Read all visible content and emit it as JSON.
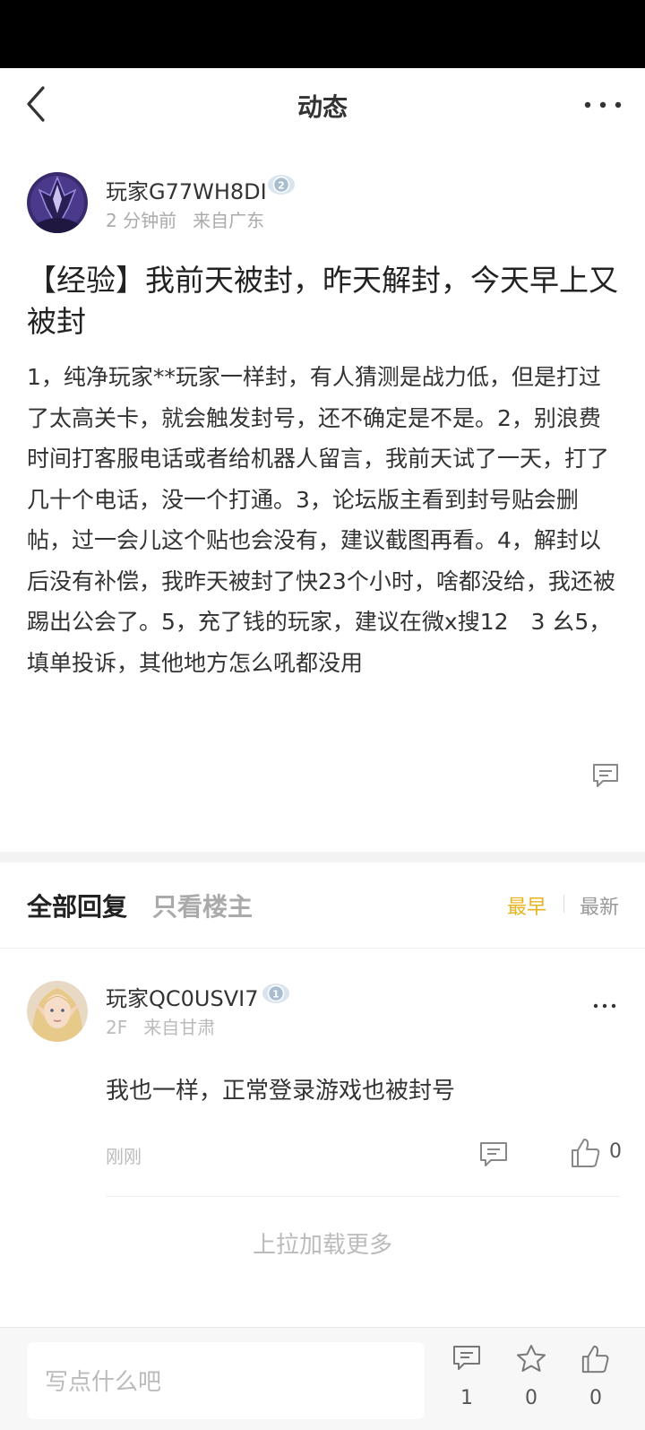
{
  "nav": {
    "title": "动态"
  },
  "post": {
    "author": {
      "name": "玩家G77WH8DI",
      "level": "2",
      "time": "2 分钟前",
      "location": "来自广东"
    },
    "title": "【经验】我前天被封，昨天解封，今天早上又被封",
    "body": "1，纯净玩家**玩家一样封，有人猜测是战力低，但是打过了太高关卡，就会触发封号，还不确定是不是。2，别浪费时间打客服电话或者给机器人留言，我前天试了一天，打了几十个电话，没一个打通。3，论坛版主看到封号贴会删帖，过一会儿这个贴也会没有，建议截图再看。4，解封以后没有补偿，我昨天被封了快23个小时，啥都没给，我还被踢出公会了。5，充了钱的玩家，建议在微x搜12　3 幺5，填单投诉，其他地方怎么吼都没用"
  },
  "replies_header": {
    "tab_all": "全部回复",
    "tab_op_only": "只看楼主",
    "sort_earliest": "最早",
    "sort_latest": "最新"
  },
  "replies": [
    {
      "name": "玩家QC0USVI7",
      "level": "1",
      "floor": "2F",
      "location": "来自甘肃",
      "text": "我也一样，正常登录游戏也被封号",
      "time": "刚刚",
      "likes": "0"
    }
  ],
  "load_more": "上拉加载更多",
  "bottom_bar": {
    "input_placeholder": "写点什么吧",
    "comment_count": "1",
    "favorite_count": "0",
    "like_count": "0"
  },
  "colors": {
    "accent": "#e6b422",
    "muted": "#aaaaaa",
    "divider": "#f3f3f3"
  }
}
